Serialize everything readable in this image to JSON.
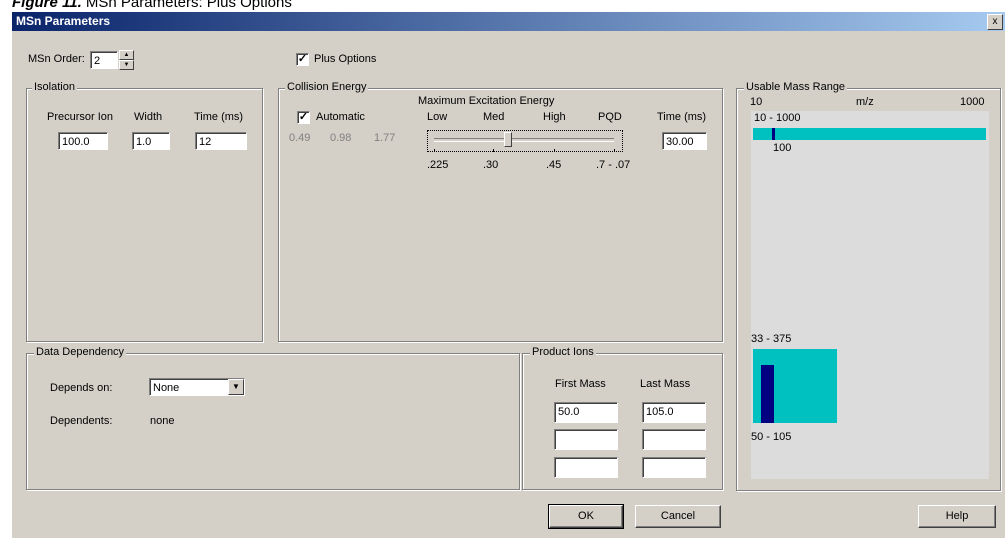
{
  "caption": {
    "figure": "Figure 11.",
    "text": "MSn Parameters: Plus Options"
  },
  "window": {
    "title": "MSn Parameters",
    "close_glyph": "x"
  },
  "msn_order": {
    "label": "MSn Order:",
    "value": "2"
  },
  "plus_options": {
    "label": "Plus Options",
    "checked": true
  },
  "isolation": {
    "title": "Isolation",
    "col_precursor": "Precursor Ion",
    "col_width": "Width",
    "col_time": "Time (ms)",
    "precursor": "100.0",
    "width": "1.0",
    "time": "12"
  },
  "collision": {
    "title": "Collision Energy",
    "automatic_label": "Automatic",
    "automatic_checked": true,
    "values": [
      "0.49",
      "0.98",
      "1.77"
    ],
    "max_exc_label": "Maximum Excitation Energy",
    "levels": [
      "Low",
      "Med",
      "High",
      "PQD"
    ],
    "ticks": [
      ".225",
      ".30",
      ".45",
      ".7 - .07"
    ],
    "slider_level": "Med",
    "time_label": "Time (ms)",
    "time_value": "30.00"
  },
  "mass_range": {
    "title": "Usable Mass Range",
    "axis_min": "10",
    "axis_unit": "m/z",
    "axis_max": "1000",
    "range1_label": "10 - 1000",
    "marker1_label": "100",
    "range2_label": "33 - 375",
    "range3_label": "50 - 105"
  },
  "data_dependency": {
    "title": "Data Dependency",
    "depends_on_label": "Depends on:",
    "depends_on_value": "None",
    "dependents_label": "Dependents:",
    "dependents_value": "none"
  },
  "product_ions": {
    "title": "Product Ions",
    "first_label": "First Mass",
    "last_label": "Last Mass",
    "rows": [
      {
        "first": "50.0",
        "last": "105.0"
      },
      {
        "first": "",
        "last": ""
      },
      {
        "first": "",
        "last": ""
      }
    ]
  },
  "buttons": {
    "ok": "OK",
    "cancel": "Cancel",
    "help": "Help"
  },
  "colors": {
    "title_start": "#0a246a",
    "title_end": "#a6caf0",
    "face": "#d4d0c8",
    "range_fill": "#00c0c0",
    "marker": "#000080"
  }
}
